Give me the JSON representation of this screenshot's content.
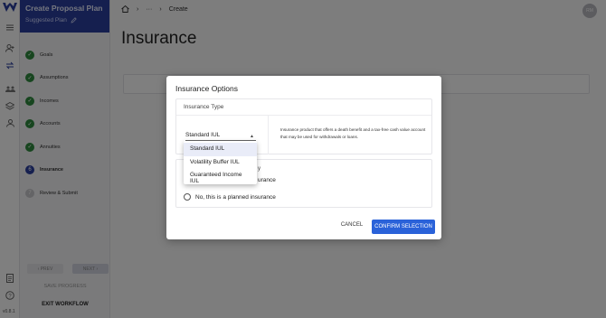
{
  "app": {
    "version": "v0.8.1"
  },
  "rail": {
    "icons": [
      "menu-icon",
      "add-user-icon",
      "swap-icon",
      "group-icon",
      "layers-icon",
      "person-icon",
      "document-icon",
      "help-icon"
    ]
  },
  "workflow": {
    "title": "Create Proposal Plan",
    "subtitle": "Suggested Plan",
    "steps": [
      {
        "label": "Goals",
        "status": "done"
      },
      {
        "label": "Assumptions",
        "status": "done"
      },
      {
        "label": "Incomes",
        "status": "done"
      },
      {
        "label": "Accounts",
        "status": "done"
      },
      {
        "label": "Annuities",
        "status": "done"
      },
      {
        "label": "Insurance",
        "status": "current",
        "number": "6"
      },
      {
        "label": "Review & Submit",
        "status": "todo",
        "number": "7"
      }
    ],
    "prev_label": "PREV",
    "next_label": "NEXT",
    "save_label": "SAVE PROGRESS",
    "exit_label": "EXIT WORKFLOW"
  },
  "header": {
    "breadcrumb": {
      "ellipsis": "···",
      "current": "Create"
    },
    "avatar_initials": "RM"
  },
  "page": {
    "title": "Insurance"
  },
  "modal": {
    "title": "Insurance Options",
    "type_section_label": "Insurance Type",
    "selected_type": "Standard IUL",
    "description": "Insurance product that offers a death benefit and a tax-free cash value account that may be used for withdrawals or loans.",
    "question_partial": "y",
    "radio_existing_partial": "urance",
    "radio_planned_label": "No, this is a planned insurance",
    "dropdown_options": [
      "Standard IUL",
      "Volatility Buffer IUL",
      "Guaranteed Income IUL"
    ],
    "cancel_label": "CANCEL",
    "confirm_label": "CONFIRM SELECTION"
  },
  "colors": {
    "brand": "#2a3e9e",
    "confirm_button": "#2a62d9",
    "done_step": "#2e8b3e"
  }
}
